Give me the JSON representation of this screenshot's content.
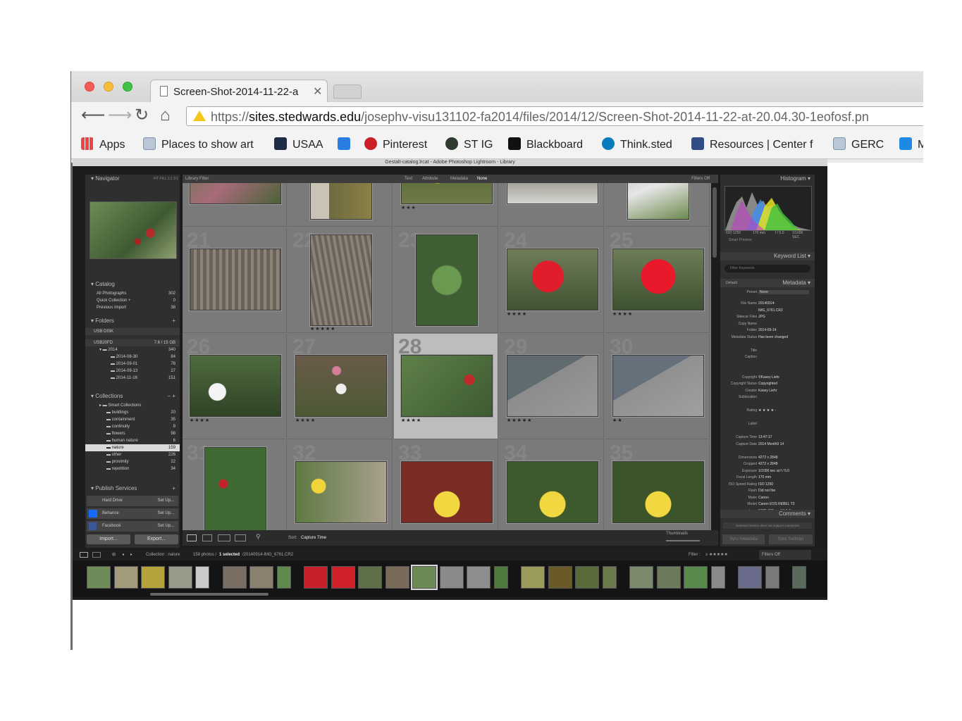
{
  "browser": {
    "tab_title": "Screen-Shot-2014-11-22-a",
    "url_scheme": "https://",
    "url_host": "sites.stedwards.edu",
    "url_path": "/josephv-visu131102-fa2014/files/2014/12/Screen-Shot-2014-11-22-at-20.04.30-1eofosf.pn",
    "bookmarks": [
      {
        "label": "Apps",
        "icon": "apps-grid-icon"
      },
      {
        "label": "Places to show art",
        "icon": "folder-icon"
      },
      {
        "label": "USAA",
        "icon": "usaa-icon"
      },
      {
        "label": "",
        "icon": "d-logo-icon"
      },
      {
        "label": "Pinterest",
        "icon": "pinterest-icon"
      },
      {
        "label": "ST IG",
        "icon": "st-ig-icon"
      },
      {
        "label": "Blackboard",
        "icon": "blackboard-icon"
      },
      {
        "label": "Think.sted",
        "icon": "drupal-icon"
      },
      {
        "label": "Resources | Center f",
        "icon": "resources-icon"
      },
      {
        "label": "GERC",
        "icon": "folder-icon"
      },
      {
        "label": "M",
        "icon": "m-icon"
      }
    ]
  },
  "lightroom": {
    "window_title": "Gestalt-catalog.lrcat - Adobe Photoshop Lightroom - Library",
    "navigator": {
      "title": "Navigator",
      "zoom_options": "FIT  FILL  1:1  3:1"
    },
    "catalog": {
      "title": "Catalog",
      "items": [
        {
          "label": "All Photographs",
          "count": "302"
        },
        {
          "label": "Quick Collection +",
          "count": "0"
        },
        {
          "label": "Previous Import",
          "count": "38"
        }
      ]
    },
    "folders": {
      "title": "Folders",
      "volumes": [
        {
          "label": "USB DISK",
          "count": ""
        },
        {
          "label": "USB20FD",
          "count": "7.6 / 15 GB"
        }
      ],
      "items": [
        {
          "label": "2014",
          "count": "340"
        },
        {
          "label": "2014-08-30",
          "count": "84"
        },
        {
          "label": "2014-09-01",
          "count": "78"
        },
        {
          "label": "2014-09-13",
          "count": "27"
        },
        {
          "label": "2014-11-16",
          "count": "151"
        }
      ]
    },
    "collections": {
      "title": "Collections",
      "items": [
        {
          "label": "Smart Collections",
          "count": ""
        },
        {
          "label": "buildings",
          "count": "20"
        },
        {
          "label": "containment",
          "count": "35"
        },
        {
          "label": "continuity",
          "count": "8"
        },
        {
          "label": "flowers",
          "count": "98"
        },
        {
          "label": "human nature",
          "count": "6"
        },
        {
          "label": "nature",
          "count": "159"
        },
        {
          "label": "other",
          "count": "226"
        },
        {
          "label": "proximity",
          "count": "22"
        },
        {
          "label": "repetition",
          "count": "34"
        }
      ],
      "selected": "nature"
    },
    "publish": {
      "title": "Publish Services",
      "items": [
        {
          "label": "Hard Drive",
          "action": "Set Up..."
        },
        {
          "label": "Behance",
          "action": "Set Up..."
        },
        {
          "label": "Facebook",
          "action": "Set Up..."
        }
      ]
    },
    "import_label": "Import...",
    "export_label": "Export...",
    "library_filter": {
      "title": "Library Filter",
      "options": [
        "Text",
        "Attribute",
        "Metadata",
        "None"
      ],
      "selected": "None",
      "filters_off": "Filters Off"
    },
    "grid": {
      "numbers": [
        "",
        "",
        "",
        "",
        "",
        "21",
        "22",
        "23",
        "24",
        "25",
        "26",
        "27",
        "28",
        "29",
        "30",
        "31",
        "32",
        "33",
        "34",
        "35"
      ],
      "stars": [
        "",
        "",
        "★★★",
        "",
        "",
        "",
        "★★★★★",
        "",
        "★★★★",
        "★★★★",
        "★★★★",
        "★★★★",
        "★★★★",
        "★★★★★",
        "★★",
        "",
        "",
        "",
        "",
        ""
      ],
      "selected_index": 12
    },
    "toolbar": {
      "sort_label": "Sort:",
      "sort_value": "Capture Time",
      "thumbnails_label": "Thumbnails"
    },
    "histogram": {
      "title": "Histogram",
      "info": [
        "ISO 1250",
        "170 mm",
        "f / 5.0",
        "1/1000 SEC"
      ],
      "smart_preview": "Smart Preview"
    },
    "keyword_list": {
      "title": "Keyword List",
      "filter_placeholder": "Filter Keywords"
    },
    "metadata": {
      "title": "Metadata",
      "preset_default": "Default",
      "preset_label": "Preset",
      "preset_value": "None",
      "fields": [
        {
          "key": "File Name",
          "value": "20140914-"
        },
        {
          "key": "",
          "value": "IMG_6761.CR2"
        },
        {
          "key": "Sidecar Files",
          "value": "JPG"
        },
        {
          "key": "Copy Name",
          "value": ""
        },
        {
          "key": "Folder",
          "value": "2014-09-14"
        },
        {
          "key": "Metadata Status",
          "value": "Has been changed"
        },
        {
          "key": "",
          "value": ""
        },
        {
          "key": "Title",
          "value": ""
        },
        {
          "key": "Caption",
          "value": ""
        },
        {
          "key": "",
          "value": ""
        },
        {
          "key": "",
          "value": ""
        },
        {
          "key": "Copyright",
          "value": "©Kasey Liehr"
        },
        {
          "key": "Copyright Status",
          "value": "Copyrighted"
        },
        {
          "key": "Creator",
          "value": "Kasey Liehr"
        },
        {
          "key": "Sublocation",
          "value": ""
        },
        {
          "key": "",
          "value": ""
        },
        {
          "key": "Rating",
          "value": "★ ★ ★ ★ ·"
        },
        {
          "key": "",
          "value": ""
        },
        {
          "key": "Label",
          "value": ""
        },
        {
          "key": "",
          "value": ""
        },
        {
          "key": "Capture Time",
          "value": "13:47:17"
        },
        {
          "key": "Capture Date",
          "value": "2014 Month9 14"
        },
        {
          "key": "",
          "value": ""
        },
        {
          "key": "Dimensions",
          "value": "4272 x 2848"
        },
        {
          "key": "Cropped",
          "value": "4272 x 2848"
        },
        {
          "key": "Exposure",
          "value": "1/1000 sec at f / 5.0"
        },
        {
          "key": "Focal Length",
          "value": "170 mm"
        },
        {
          "key": "ISO Speed Rating",
          "value": "ISO 1250"
        },
        {
          "key": "Flash",
          "value": "Did not fire"
        },
        {
          "key": "Make",
          "value": "Canon"
        },
        {
          "key": "Model",
          "value": "Canon EOS REBEL T3"
        },
        {
          "key": "Lens",
          "value": "EF75-300mm f/4-5.6"
        },
        {
          "key": "GPS",
          "value": ""
        }
      ]
    },
    "comments": {
      "title": "Comments",
      "note": "Selected service does not support comments"
    },
    "sync_metadata": "Sync Metadata",
    "sync_settings": "Sync Settings",
    "filmstrip_bar": {
      "collection": "Collection : nature",
      "count": "159 photos /",
      "selected": "1 selected",
      "file": "/20140914-IMG_6761.CR2",
      "filter_label": "Filter :",
      "filter_value": "Filters Off"
    }
  }
}
